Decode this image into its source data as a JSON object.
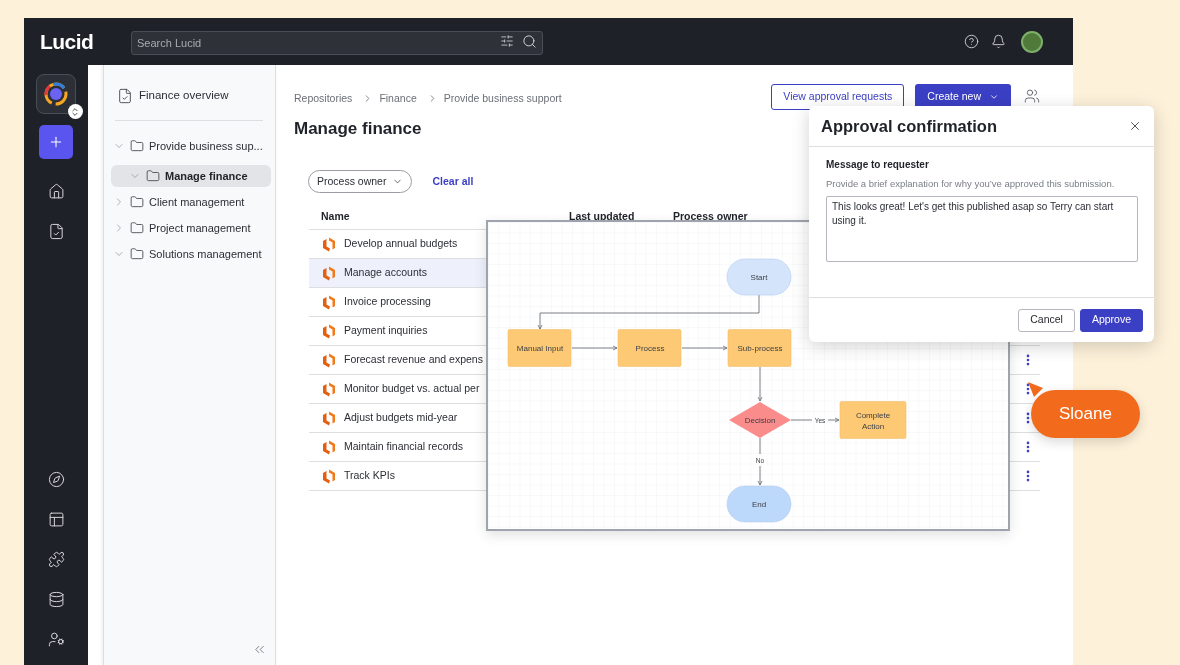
{
  "topbar": {
    "logo": "Lucid",
    "search": {
      "placeholder": "Search Lucid"
    }
  },
  "tree": {
    "overview": "Finance overview",
    "items": [
      {
        "label": "Provide business sup...",
        "expanded": true,
        "selected": false,
        "children": [
          {
            "label": "Manage finance",
            "expanded": true,
            "selected": true
          }
        ]
      },
      {
        "label": "Client management",
        "expanded": false,
        "selected": false
      },
      {
        "label": "Project management",
        "expanded": false,
        "selected": false
      },
      {
        "label": "Solutions management",
        "expanded": true,
        "selected": false
      }
    ]
  },
  "breadcrumbs": [
    "Repositories",
    "Finance",
    "Provide business support"
  ],
  "title": "Manage finance",
  "actions": {
    "view_requests": "View approval requests",
    "create_new": "Create new"
  },
  "filters": {
    "dropdown": "Process owner",
    "clear": "Clear all"
  },
  "table": {
    "columns": [
      "Name",
      "Last updated",
      "Process owner"
    ],
    "rows": [
      {
        "name": "Develop annual budgets",
        "highlighted": false
      },
      {
        "name": "Manage accounts",
        "highlighted": true
      },
      {
        "name": "Invoice processing",
        "highlighted": false
      },
      {
        "name": "Payment inquiries",
        "highlighted": false
      },
      {
        "name": "Forecast revenue and expens",
        "highlighted": false,
        "menu": true
      },
      {
        "name": "Monitor budget vs. actual per",
        "highlighted": false,
        "menu": true
      },
      {
        "name": "Adjust budgets mid-year",
        "highlighted": false,
        "menu": true
      },
      {
        "name": "Maintain financial records",
        "highlighted": false,
        "menu": true
      },
      {
        "name": "Track KPIs",
        "highlighted": false,
        "menu": true
      }
    ]
  },
  "flowchart": {
    "nodes": [
      {
        "kind": "terminal",
        "label": "Start"
      },
      {
        "kind": "process",
        "label": "Manual Input"
      },
      {
        "kind": "process",
        "label": "Process"
      },
      {
        "kind": "process",
        "label": "Sub-process"
      },
      {
        "kind": "decision",
        "label": "Decision"
      },
      {
        "kind": "process",
        "label": "Complete Action"
      },
      {
        "kind": "terminal",
        "label": "End"
      }
    ],
    "edge_labels": [
      "Yes",
      "No"
    ]
  },
  "dialog": {
    "title": "Approval confirmation",
    "field_label": "Message to requester",
    "help": "Provide a brief explanation for why you’ve approved this submission.",
    "message": "This looks great! Let's get this published asap so Terry can start using it.",
    "buttons": [
      {
        "kind": "secondary",
        "label": "Cancel"
      },
      {
        "kind": "primary",
        "label": "Approve"
      }
    ]
  },
  "cursor_tag": {
    "name": "Sloane"
  }
}
